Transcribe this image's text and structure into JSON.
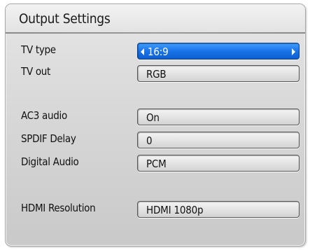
{
  "header": {
    "title": "Output Settings"
  },
  "settings": [
    {
      "label": "TV type",
      "value": "16:9",
      "selected": true
    },
    {
      "label": "TV out",
      "value": "RGB",
      "selected": false
    },
    {
      "label": "AC3 audio",
      "value": "On",
      "selected": false
    },
    {
      "label": "SPDIF Delay",
      "value": "0",
      "selected": false
    },
    {
      "label": "Digital Audio",
      "value": "PCM",
      "selected": false
    },
    {
      "label": "HDMI Resolution",
      "value": "HDMI 1080p",
      "selected": false
    }
  ],
  "icons": {
    "left": "arrow-left-icon",
    "right": "arrow-right-icon"
  },
  "colors": {
    "accent": "#1a73e8",
    "panel": "#d9d9d9",
    "text": "#111111"
  }
}
